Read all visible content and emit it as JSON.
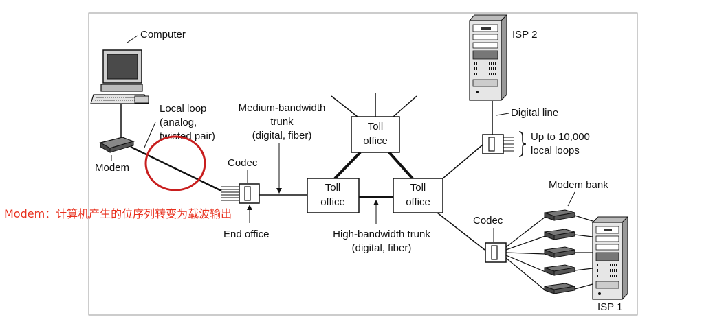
{
  "labels": {
    "computer": "Computer",
    "local_loop": [
      "Local loop",
      "(analog,",
      "twisted pair)"
    ],
    "modem": "Modem",
    "codec_left": "Codec",
    "end_office": "End office",
    "medium_trunk": [
      "Medium-bandwidth",
      "trunk",
      "(digital, fiber)"
    ],
    "toll_office_top": [
      "Toll",
      "office"
    ],
    "toll_office_left": [
      "Toll",
      "office"
    ],
    "toll_office_right": [
      "Toll",
      "office"
    ],
    "high_trunk": [
      "High-bandwidth trunk",
      "(digital, fiber)"
    ],
    "isp2": "ISP 2",
    "digital_line": "Digital line",
    "local_loops": [
      "Up to 10,000",
      "local loops"
    ],
    "modem_bank": "Modem bank",
    "codec_right": "Codec",
    "isp1": "ISP 1"
  },
  "annotation": {
    "text": "Modem：计算机产生的位序列转变为载波输出",
    "color": "#e8301e"
  },
  "colors": {
    "frame": "#9a9a9a",
    "line": "#111111",
    "highlight_circle": "#c81e1e",
    "device_dark": "#555555",
    "device_light": "#d8d8d8"
  }
}
